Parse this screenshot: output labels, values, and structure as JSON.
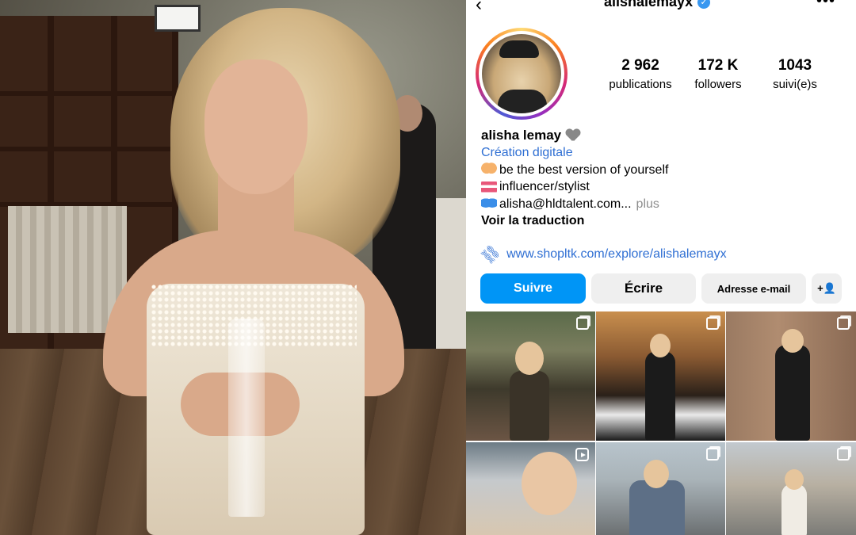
{
  "profile": {
    "handle": "alishalemayx",
    "stats": [
      {
        "value": "2 962",
        "label": "publications"
      },
      {
        "value": "172 K",
        "label": "followers"
      },
      {
        "value": "1043",
        "label": "suivi(e)s"
      }
    ],
    "name": "alisha lemay",
    "category": "Création digitale",
    "bio_lines": [
      {
        "emoji": "hands-heart-emoji",
        "text": "be the best version of yourself"
      },
      {
        "emoji": "bikini-emoji",
        "text": "influencer/stylist"
      },
      {
        "emoji": "butterfly-emoji",
        "text": "alisha@hldtalent.com..."
      }
    ],
    "more_label": "plus",
    "translate_label": "Voir la traduction",
    "link": "www.shopltk.com/explore/alishalemayx",
    "buttons": {
      "follow": "Suivre",
      "write": "Écrire",
      "email": "Adresse e-mail",
      "add_user": "+👤"
    }
  },
  "colors": {
    "accent": "#0095f6",
    "link": "#2f6fd3",
    "verified": "#3897f0"
  },
  "icons": {
    "back": "‹",
    "verified": "✓",
    "more": "•••",
    "link": "⛓"
  },
  "grid": [
    {
      "type": "carousel"
    },
    {
      "type": "carousel"
    },
    {
      "type": "carousel"
    },
    {
      "type": "reel"
    },
    {
      "type": "carousel"
    },
    {
      "type": "carousel"
    }
  ]
}
